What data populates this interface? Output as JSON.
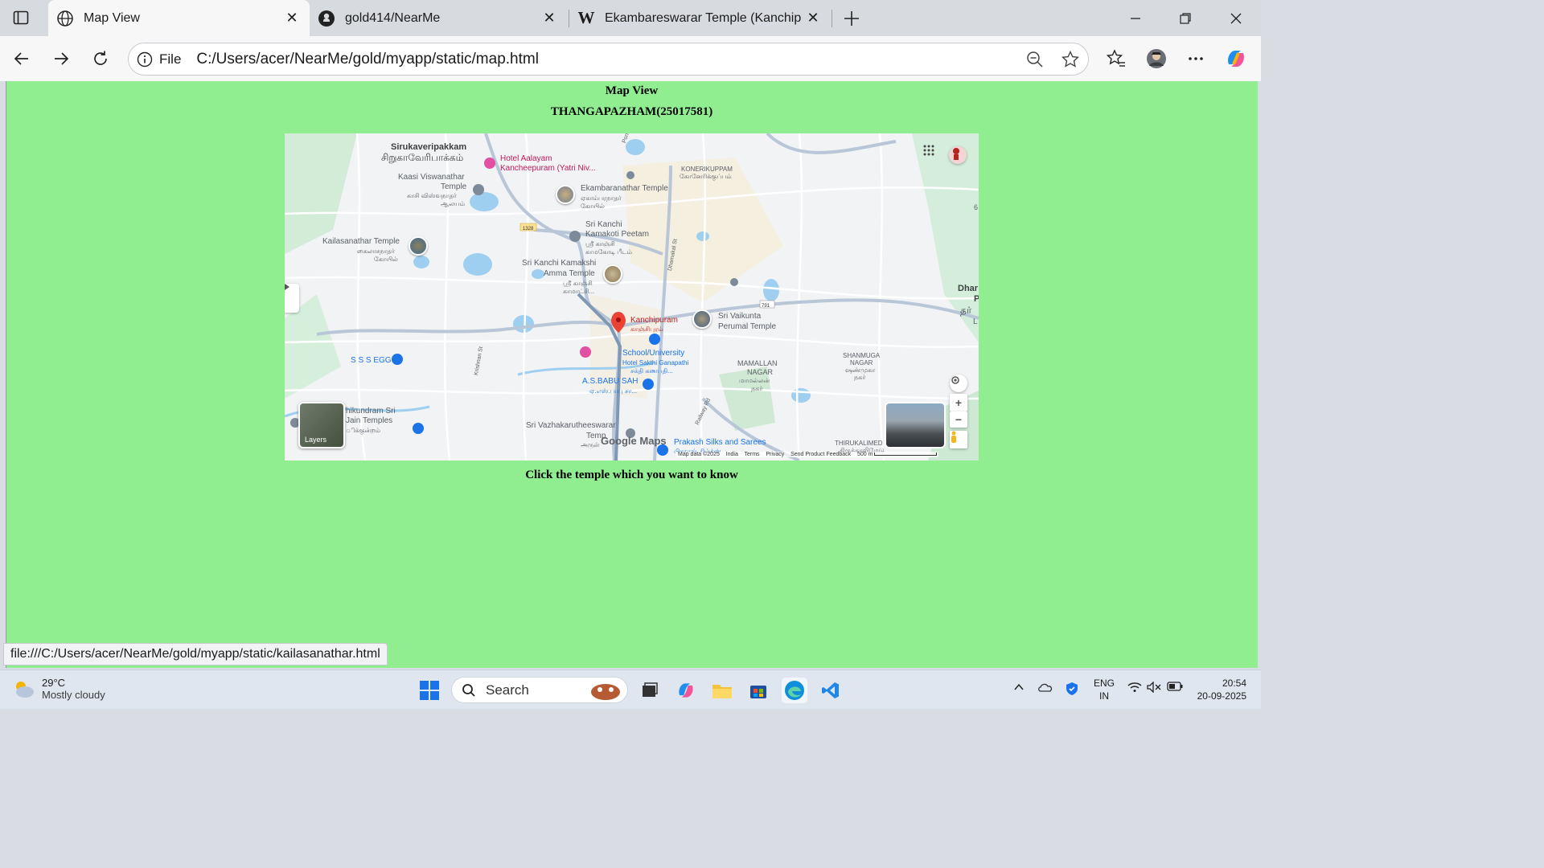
{
  "browser": {
    "tabs": [
      {
        "title": "Map View",
        "favicon": "globe-icon",
        "active": true
      },
      {
        "title": "gold414/NearMe",
        "favicon": "github-icon",
        "active": false
      },
      {
        "title": "Ekambareswarar Temple (Kanchip",
        "favicon": "wikipedia-icon",
        "active": false
      }
    ],
    "address": {
      "scheme_label": "File",
      "url": "C:/Users/acer/NearMe/gold/myapp/static/map.html"
    }
  },
  "page": {
    "heading": "Map View",
    "subheading": "THANGAPAZHAM(25017581)",
    "hint": "Click the temple which you want to know"
  },
  "map": {
    "labels": {
      "sirukaveri": "Sirukaveripakkam",
      "sirukaveri_ta": "சிறுகாவேரிபாக்கம்",
      "hotel_aalayam": "Hotel Aalayam",
      "hotel_aalayam2": "Kancheepuram (Yatri Niv...",
      "kaasi": "Kaasi Viswanathar",
      "kaasi2": "Temple",
      "kaasi_ta": "காசி விஸ்வநாதர்",
      "kaasi_ta2": "ஆலயம்",
      "ekambaranathar": "Ekambaranathar Temple",
      "ekambaranathar_ta": "ஏகாம்பரநாதர்",
      "ekambaranathar_ta2": "கோயில்",
      "konerikuppam": "KONERIKUPPAM",
      "konerikuppam_ta": "கோனேரிக்குப்பம்",
      "kamakoti": "Sri Kanchi",
      "kamakoti2": "Kamakoti Peetam",
      "kamakoti_ta": "ஸ்ரீ காஞ்சி",
      "kamakoti_ta2": "காமகோடி பீடம்",
      "kailasanathar": "Kailasanathar Temple",
      "kailasanathar_ta": "கைலாசநாதர்",
      "kailasanathar_ta2": "கோயில்",
      "kamakshi": "Sri Kanchi Kamakshi",
      "kamakshi2": "Amma Temple",
      "kamakshi_ta": "ஸ்ரீ காஞ்சி",
      "kamakshi_ta2": "காமாட்சி...",
      "kanchipuram": "Kanchipuram",
      "kanchipuram_ta": "காஞ்சிபுரம்",
      "vaikunta": "Sri Vaikunta",
      "vaikunta2": "Perumal Temple",
      "school": "School/University",
      "hotel_sakthi": "Hotel Sakthi Ganapathi",
      "hotel_sakthi_ta": "சக்தி கணபதி...",
      "sss_egg": "S S S EGG",
      "mamallan": "MAMALLAN",
      "mamallan2": "NAGAR",
      "mamallan_ta": "மாமல்லன்",
      "mamallan_ta2": "நகர்",
      "shanmuga": "SHANMUGA",
      "shanmuga2": "NAGAR",
      "shanmuga_ta": "ஷண்முகா",
      "shanmuga_ta2": "நகர்",
      "babu_sah": "A.S.BABU SAH",
      "babu_sah_ta": "ஏ.எஸ்.பாபு சா...",
      "thirukundram": "hikundram Sri",
      "thirukundram2": "Jain Temples",
      "thirukundram_ta": "ிக்குன்றம்",
      "vazhakaru": "Sri Vazhakarutheeswarar",
      "vazhakaru2": "Temp",
      "vazhakaru_ta": "அருள்",
      "prakash": "Prakash Silks and Sarees",
      "prakash_ta": "பிரகாஷ் சில்க்ஸ்",
      "thirukalimedu": "THIRUKALIMED",
      "thirukalimedu_ta": "திருக்காலிமேடு",
      "dhar": "Dhar",
      "dhar2": "P",
      "dhar_ta": "தர்",
      "dhar3": "L",
      "edge6": "6",
      "road_1328": "1328",
      "road_791": "791",
      "ponneri": "Ponneri",
      "dhamakalsi": "Dhamakal St",
      "krishnan": "Krishnan St",
      "railway": "Railway Rd",
      "layers": "Layers",
      "google": "Google Maps"
    },
    "attribution": {
      "data": "Map data ©2025",
      "india": "India",
      "terms": "Terms",
      "privacy": "Privacy",
      "feedback": "Send Product Feedback",
      "scale": "500 m"
    }
  },
  "status_link": "file:///C:/Users/acer/NearMe/gold/myapp/static/kailasanathar.html",
  "taskbar": {
    "weather_temp": "29°C",
    "weather_cond": "Mostly cloudy",
    "search_label": "Search",
    "lang1": "ENG",
    "lang2": "IN",
    "time": "20:54",
    "date": "20-09-2025"
  },
  "colors": {
    "page_bg": "#90ee90",
    "pin_red": "#ea4335"
  }
}
